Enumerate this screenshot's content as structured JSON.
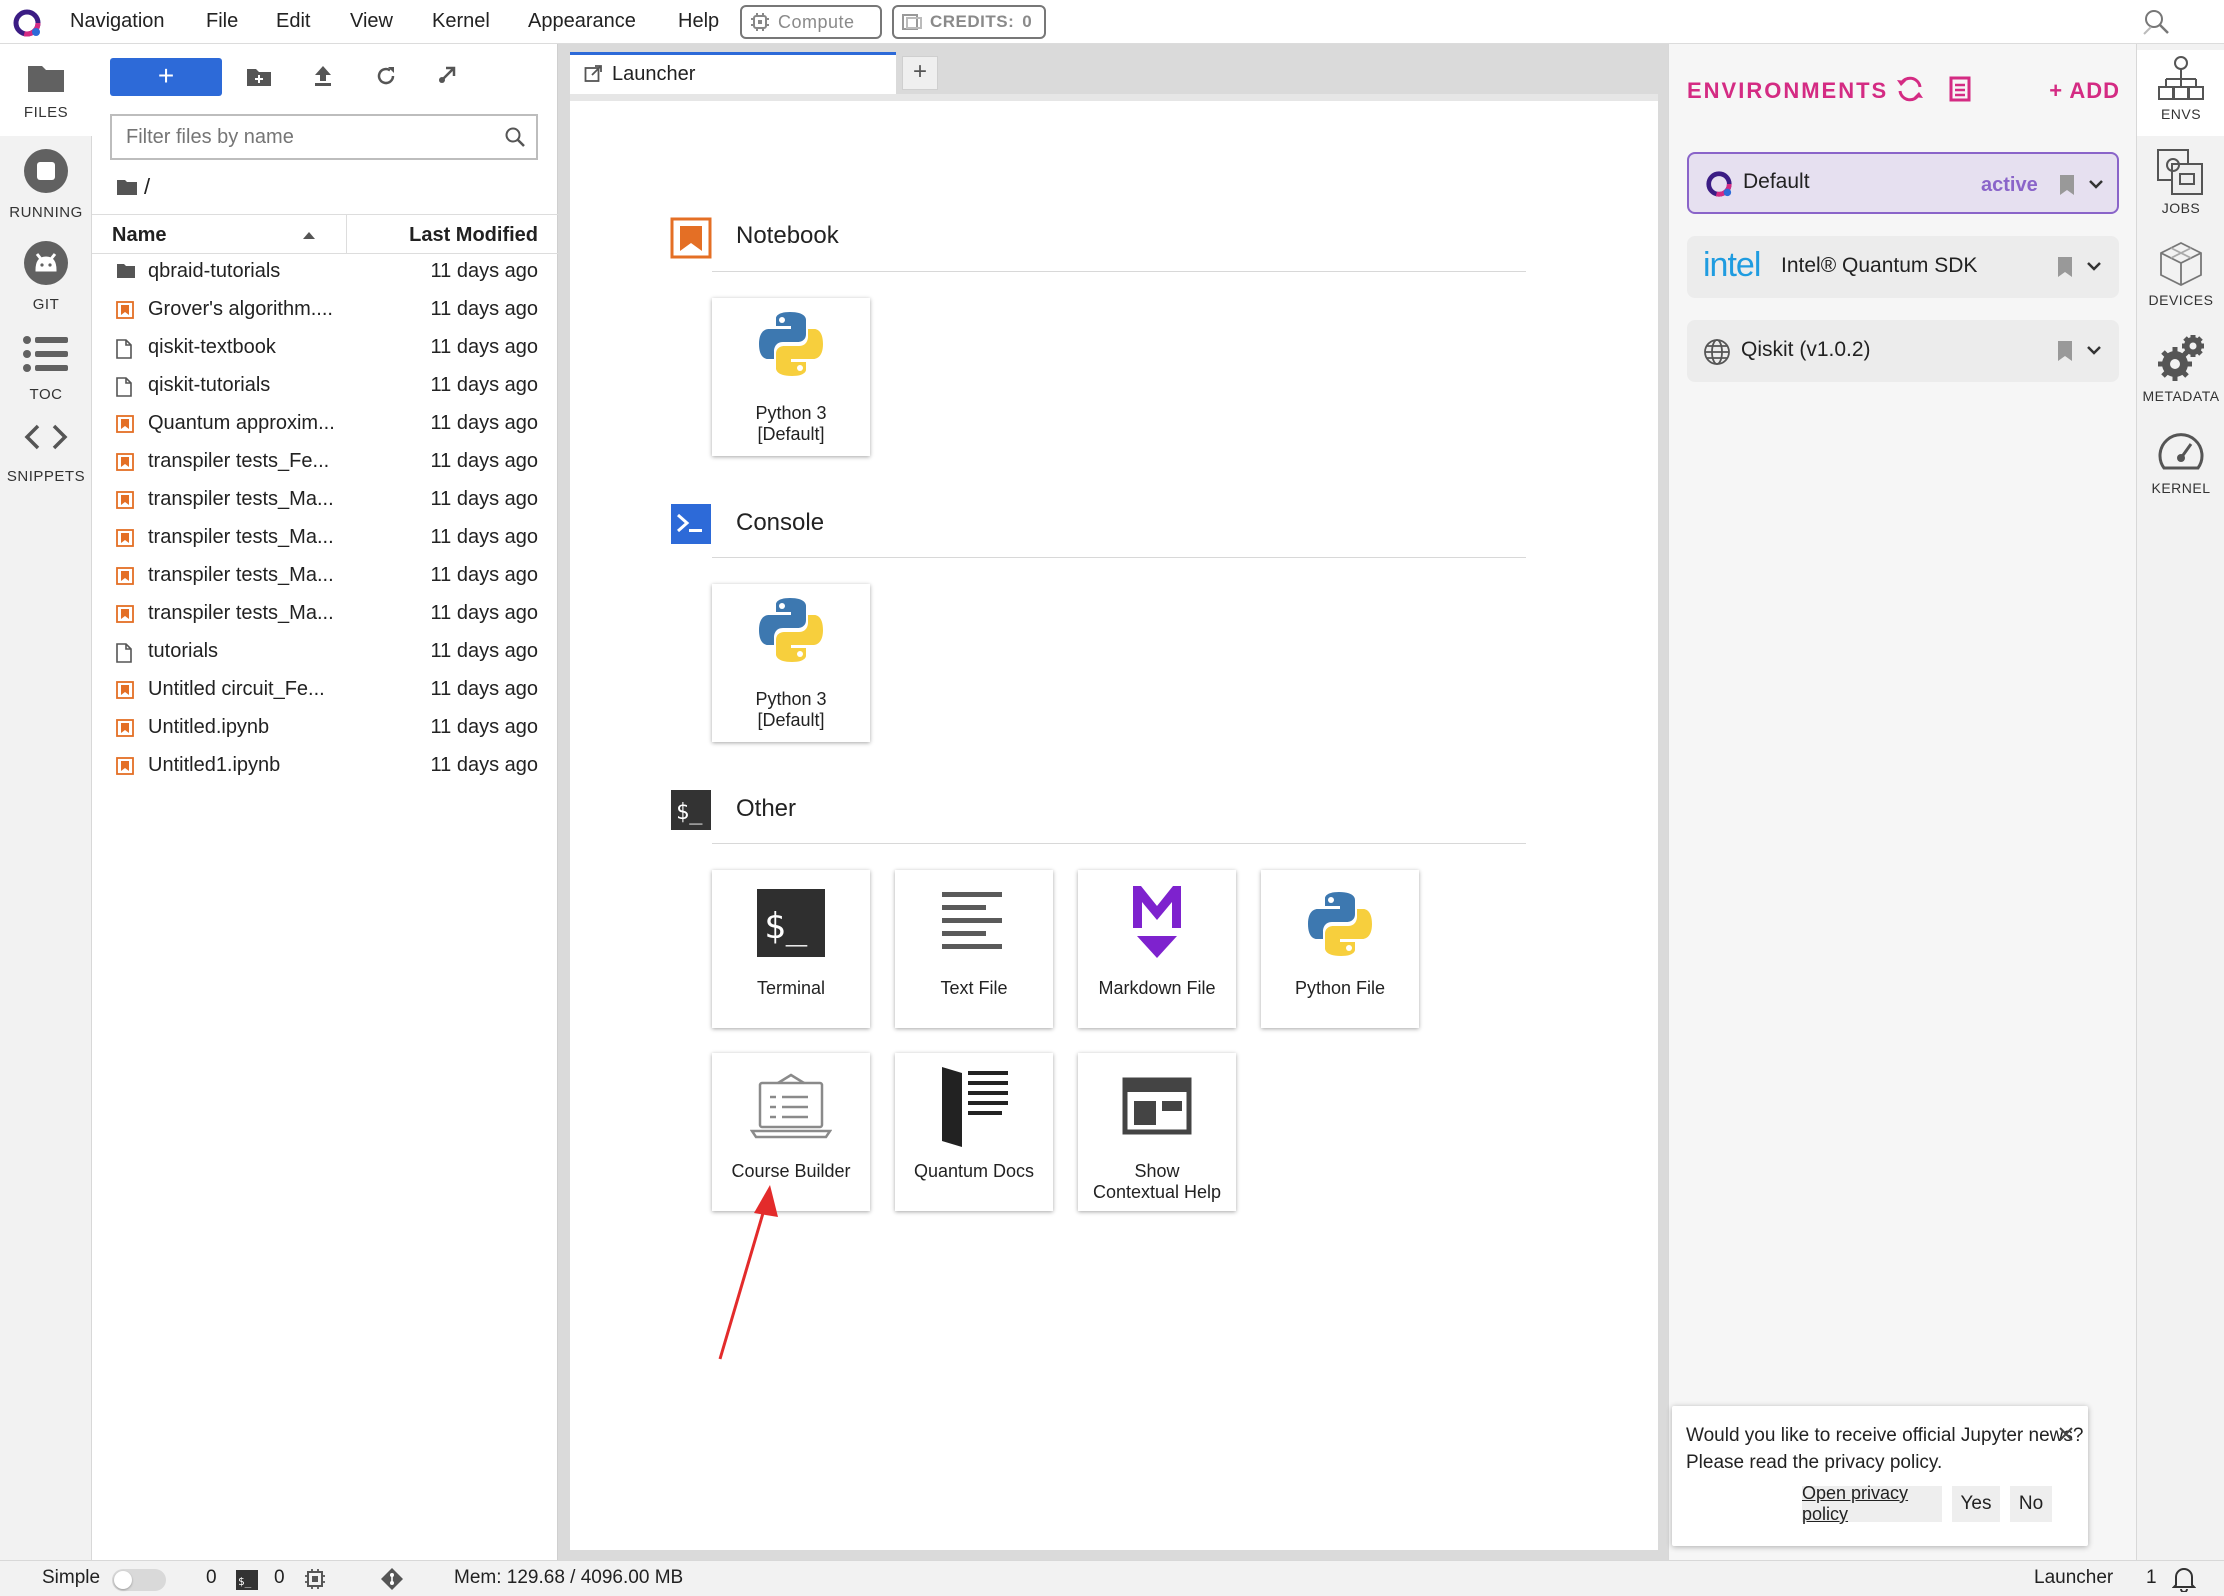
{
  "menubar": {
    "items": [
      "Navigation",
      "File",
      "Edit",
      "View",
      "Kernel",
      "Appearance",
      "Help"
    ],
    "compute_label": "Compute",
    "credits_label": "CREDITS:",
    "credits_value": "0"
  },
  "leftbar": {
    "items": [
      "FILES",
      "RUNNING",
      "GIT",
      "TOC",
      "SNIPPETS"
    ]
  },
  "filebrowser": {
    "new_label": "+",
    "filter_placeholder": "Filter files by name",
    "path": "/",
    "col_name": "Name",
    "col_modified": "Last Modified",
    "files": [
      {
        "name": "qbraid-tutorials",
        "modified": "11 days ago",
        "kind": "folder"
      },
      {
        "name": "Grover's algorithm....",
        "modified": "11 days ago",
        "kind": "notebook"
      },
      {
        "name": "qiskit-textbook",
        "modified": "11 days ago",
        "kind": "file"
      },
      {
        "name": "qiskit-tutorials",
        "modified": "11 days ago",
        "kind": "file"
      },
      {
        "name": "Quantum approxim...",
        "modified": "11 days ago",
        "kind": "notebook"
      },
      {
        "name": "transpiler tests_Fe...",
        "modified": "11 days ago",
        "kind": "notebook"
      },
      {
        "name": "transpiler tests_Ma...",
        "modified": "11 days ago",
        "kind": "notebook"
      },
      {
        "name": "transpiler tests_Ma...",
        "modified": "11 days ago",
        "kind": "notebook"
      },
      {
        "name": "transpiler tests_Ma...",
        "modified": "11 days ago",
        "kind": "notebook"
      },
      {
        "name": "transpiler tests_Ma...",
        "modified": "11 days ago",
        "kind": "notebook"
      },
      {
        "name": "tutorials",
        "modified": "11 days ago",
        "kind": "file"
      },
      {
        "name": "Untitled circuit_Fe...",
        "modified": "11 days ago",
        "kind": "notebook"
      },
      {
        "name": "Untitled.ipynb",
        "modified": "11 days ago",
        "kind": "notebook"
      },
      {
        "name": "Untitled1.ipynb",
        "modified": "11 days ago",
        "kind": "notebook"
      }
    ]
  },
  "tabs": {
    "launcher_label": "Launcher",
    "add_label": "+"
  },
  "launcher": {
    "notebook_title": "Notebook",
    "console_title": "Console",
    "other_title": "Other",
    "notebook_card": {
      "line1": "Python 3",
      "line2": "[Default]"
    },
    "console_card": {
      "line1": "Python 3",
      "line2": "[Default]"
    },
    "other_cards": [
      {
        "line1": "Terminal",
        "line2": ""
      },
      {
        "line1": "Text File",
        "line2": ""
      },
      {
        "line1": "Markdown File",
        "line2": ""
      },
      {
        "line1": "Python File",
        "line2": ""
      },
      {
        "line1": "Course Builder",
        "line2": ""
      },
      {
        "line1": "Quantum Docs",
        "line2": ""
      },
      {
        "line1": "Show",
        "line2": "Contextual Help"
      }
    ]
  },
  "environments": {
    "title": "ENVIRONMENTS",
    "add_label": "+ ADD",
    "items": [
      {
        "name": "Default",
        "status": "active"
      },
      {
        "name": "Intel® Quantum SDK",
        "status": "",
        "brand": "intel"
      },
      {
        "name": "Qiskit (v1.0.2)",
        "status": ""
      }
    ]
  },
  "rightbar": {
    "items": [
      "ENVS",
      "JOBS",
      "DEVICES",
      "METADATA",
      "KERNEL"
    ]
  },
  "notification": {
    "line1": "Would you like to receive official Jupyter news?",
    "line2": "Please read the privacy policy.",
    "open_label": "Open privacy policy",
    "yes_label": "Yes",
    "no_label": "No"
  },
  "statusbar": {
    "mode_label": "Simple",
    "kernels_count": "0",
    "terminals_count": "0",
    "memory": "Mem: 129.68 / 4096.00 MB",
    "launcher_label": "Launcher",
    "notif_count": "1"
  },
  "colors": {
    "accent_blue": "#2d6ad8",
    "accent_pink": "#d42b83",
    "notebook_orange": "#e46f25",
    "env_active_bg": "#e6e0f0",
    "env_active_border": "#8a64c9",
    "markdown_purple": "#7e22ce",
    "annotation_red": "#e32b2b"
  }
}
